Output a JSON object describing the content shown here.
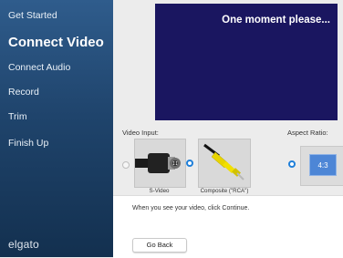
{
  "sidebar": {
    "items": [
      {
        "label": "Get Started"
      },
      {
        "label": "Connect Video"
      },
      {
        "label": "Connect Audio"
      },
      {
        "label": "Record"
      },
      {
        "label": "Trim"
      },
      {
        "label": "Finish Up"
      }
    ],
    "active_index": 1,
    "brand": "elgato"
  },
  "preview": {
    "status": "One moment please..."
  },
  "video_input": {
    "label": "Video Input:",
    "options": [
      {
        "label": "S-Video",
        "icon": "svideo-connector-icon",
        "selected": false
      },
      {
        "label": "Composite (\"RCA\")",
        "icon": "rca-connector-icon",
        "selected": true
      }
    ]
  },
  "aspect_ratio": {
    "label": "Aspect Ratio:",
    "selected": "4:3"
  },
  "instructions": {
    "text": "When you see your video, click Continue."
  },
  "buttons": {
    "go_back": "Go Back"
  },
  "colors": {
    "sidebar_top": "#2f5c8c",
    "sidebar_bottom": "#13304f",
    "preview_bg": "#1a1660",
    "radio_selected": "#1f7fd9",
    "aspect_badge": "#4d86d6"
  }
}
